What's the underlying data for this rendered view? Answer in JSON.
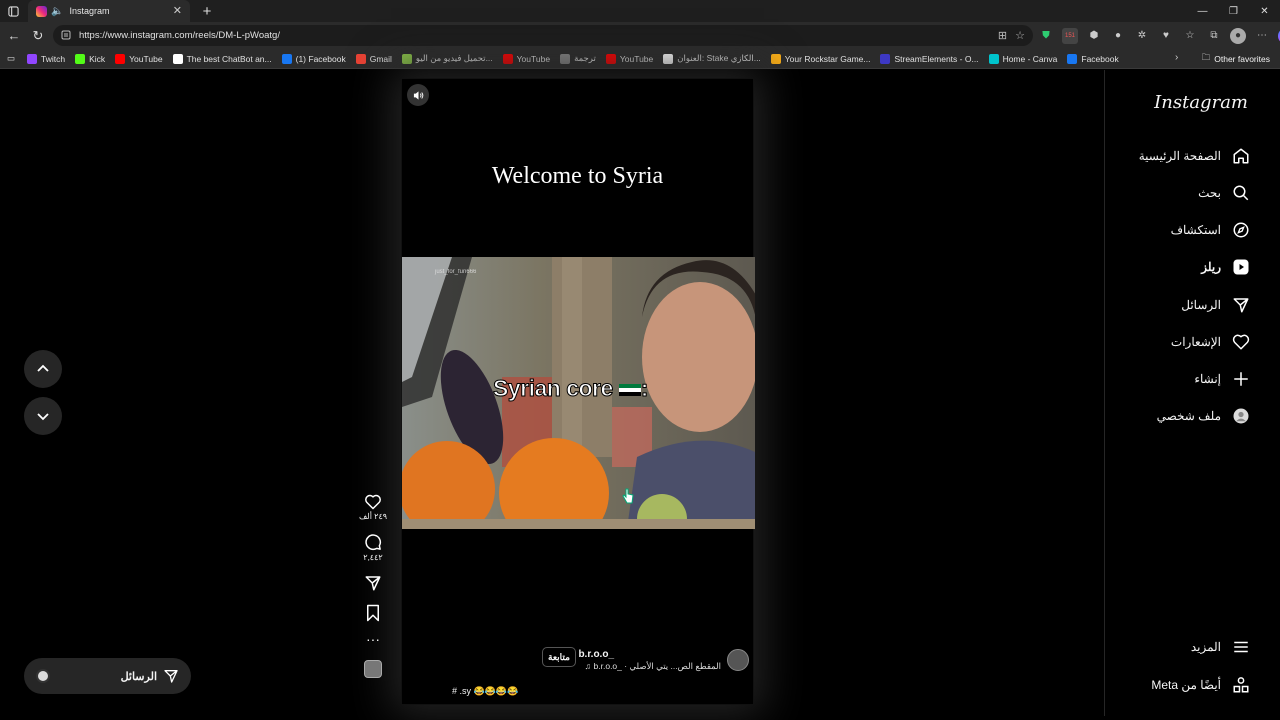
{
  "browser": {
    "tab_title": "Instagram",
    "url": "https://www.instagram.com/reels/DM-L-pWoatg/",
    "bookmarks": [
      {
        "label": "Twitch",
        "color": "#9146ff"
      },
      {
        "label": "Kick",
        "color": "#53fc18"
      },
      {
        "label": "YouTube",
        "color": "#ff0000"
      },
      {
        "label": "The best ChatBot an...",
        "color": "#ffffff"
      },
      {
        "label": "(1) Facebook",
        "color": "#1877f2"
      },
      {
        "label": "Gmail",
        "color": "#ea4335"
      },
      {
        "label": "تحميل فيديو من اليو...",
        "color": "#8bc34a"
      },
      {
        "label": "YouTube",
        "color": "#ff0000"
      },
      {
        "label": "ترجمة",
        "color": "#888888"
      },
      {
        "label": "YouTube",
        "color": "#ff0000"
      },
      {
        "label": "العنوان: Stake الكازي...",
        "color": "#ffffff"
      },
      {
        "label": "Your Rockstar Game...",
        "color": "#fcaf17"
      },
      {
        "label": "StreamElements - O...",
        "color": "#3d38c4"
      },
      {
        "label": "Home - Canva",
        "color": "#00c4cc"
      },
      {
        "label": "Facebook",
        "color": "#1877f2"
      }
    ],
    "other_favorites": "Other favorites"
  },
  "sidebar": {
    "logo": "Instagram",
    "items": [
      {
        "label": "الصفحة الرئيسية",
        "icon": "home-icon"
      },
      {
        "label": "بحث",
        "icon": "search-icon"
      },
      {
        "label": "استكشاف",
        "icon": "explore-icon"
      },
      {
        "label": "ريلز",
        "icon": "reels-icon"
      },
      {
        "label": "الرسائل",
        "icon": "messages-icon"
      },
      {
        "label": "الإشعارات",
        "icon": "heart-icon"
      },
      {
        "label": "إنشاء",
        "icon": "plus-icon"
      },
      {
        "label": "ملف شخصي",
        "icon": "profile-icon"
      }
    ],
    "more": "المزيد",
    "also_from_meta": "أيضًا من Meta"
  },
  "reel": {
    "title": "Welcome to Syria",
    "video_caption": "Syrian core",
    "watermark": "just_for_fun666",
    "username": "b.r.o.o_",
    "follow": "متابعة",
    "audio": "b.r.o.o_ · المقطع الص... يتي الأصلي",
    "hashtags": "# .sy 😂😂😂😂",
    "likes": "٢٤٩ ألف",
    "comments": "٢,٤٤٢"
  },
  "messages_pill": {
    "label": "الرسائل"
  },
  "colors": {
    "background": "#000000",
    "chrome": "#2b2b2b",
    "active_text": "#f5f5f5"
  }
}
